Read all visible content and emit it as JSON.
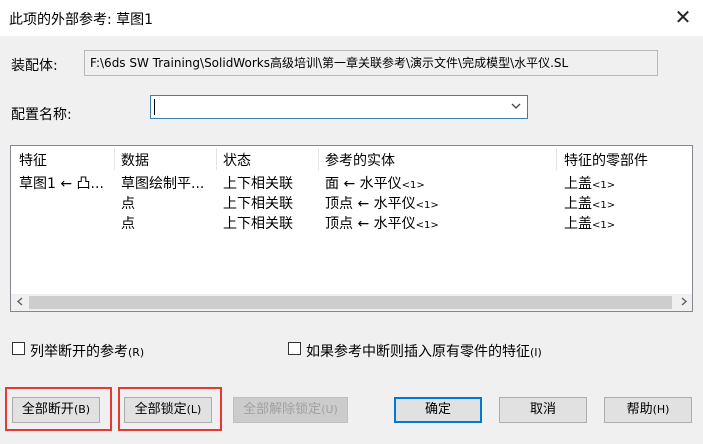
{
  "window": {
    "title": "此项的外部参考: 草图1",
    "close_glyph": "✕"
  },
  "assembly": {
    "label": "装配体:",
    "path": "F:\\6ds SW Training\\SolidWorks高级培训\\第一章关联参考\\演示文件\\完成模型\\水平仪.SL"
  },
  "config": {
    "label": "配置名称:",
    "value": ""
  },
  "table": {
    "headers": [
      "特征",
      "数据",
      "状态",
      "参考的实体",
      "特征的零部件"
    ],
    "rows": [
      {
        "feature": "草图1 ← 凸...",
        "data": "草图绘制平...",
        "status": "上下相关联",
        "entity": "面 ← 水平仪",
        "entity_ref": "<1>",
        "component": "上盖",
        "component_ref": "<1>"
      },
      {
        "feature": "",
        "data": "点",
        "status": "上下相关联",
        "entity": "顶点 ← 水平仪",
        "entity_ref": "<1>",
        "component": "上盖",
        "component_ref": "<1>"
      },
      {
        "feature": "",
        "data": "点",
        "status": "上下相关联",
        "entity": "顶点 ← 水平仪",
        "entity_ref": "<1>",
        "component": "上盖",
        "component_ref": "<1>"
      }
    ]
  },
  "options": {
    "list_broken": {
      "label": "列举断开的参考",
      "hotkey": "(R)",
      "checked": false
    },
    "insert_original": {
      "label": "如果参考中断则插入原有零件的特征",
      "hotkey": "(I)",
      "checked": false
    }
  },
  "buttons": {
    "break_all": "全部断开",
    "break_all_key": "(B)",
    "lock_all": "全部锁定",
    "lock_all_key": "(L)",
    "unlock_all": "全部解除锁定",
    "unlock_all_key": "(U)",
    "ok": "确定",
    "cancel": "取消",
    "help": "帮助",
    "help_key": "(H)"
  },
  "colors": {
    "highlight": "#e53935",
    "focus": "#0078d7"
  }
}
